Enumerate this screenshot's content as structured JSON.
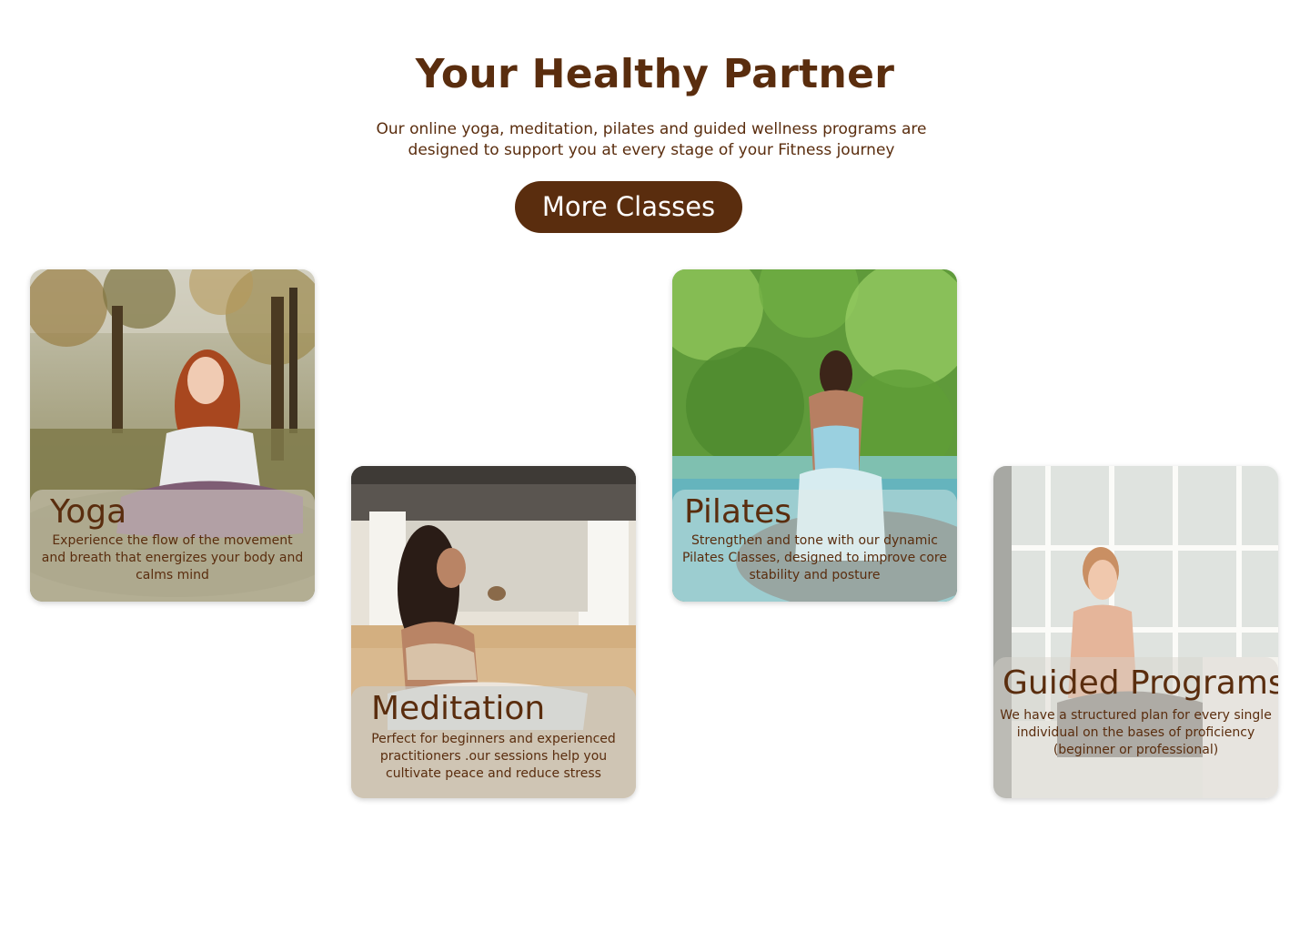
{
  "hero": {
    "title": "Your Healthy Partner",
    "subtitle": "Our online yoga, meditation, pilates and guided wellness programs are designed to support you at every stage of your Fitness journey",
    "button_label": "More Classes"
  },
  "cards": [
    {
      "title": "Yoga",
      "text": "Experience the flow of the movement and breath that energizes your body and calms mind",
      "image": "woman-meditating-outdoors-photo"
    },
    {
      "title": "Meditation",
      "text": "Perfect for beginners and experienced practitioners .our sessions help you cultivate peace and reduce stress",
      "image": "woman-meditating-studio-photo"
    },
    {
      "title": "Pilates",
      "text": "Strengthen and tone with our dynamic Pilates Classes, designed to improve core stability and posture",
      "image": "woman-stretching-by-river-photo"
    },
    {
      "title": "Guided Programs",
      "text": "We have a structured plan for every single individual on the bases of proficiency (beginner or professional)",
      "image": "woman-sitting-by-window-photo"
    }
  ],
  "colors": {
    "brand": "#5a2d0e",
    "button_text": "#ffffff",
    "background": "#ffffff"
  }
}
